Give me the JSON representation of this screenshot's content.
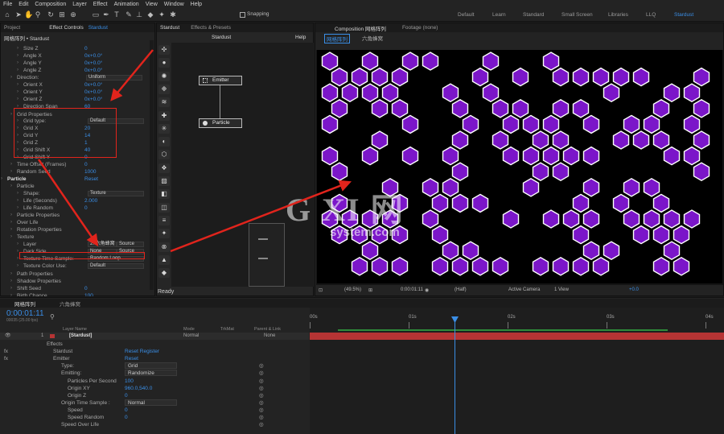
{
  "menu": [
    "File",
    "Edit",
    "Composition",
    "Layer",
    "Effect",
    "Animation",
    "View",
    "Window",
    "Help"
  ],
  "toolbar": {
    "snapping": "Snapping",
    "workspaces": [
      "Default",
      "Learn",
      "Standard",
      "Small Screen",
      "Libraries",
      "LLQ",
      "Stardust"
    ]
  },
  "left_panel": {
    "tabs": [
      "Project",
      "Effect Controls",
      "Stardust"
    ],
    "title": "网格阵列 • Stardust",
    "rows": [
      {
        "label": "Size Z",
        "value": "0"
      },
      {
        "label": "Angle X",
        "value": "0x+0.0°"
      },
      {
        "label": "Angle Y",
        "value": "0x+0.0°"
      },
      {
        "label": "Angle Z",
        "value": "0x+0.0°"
      },
      {
        "label": "Direction:",
        "value": "Uniform"
      },
      {
        "label": "Orient X",
        "value": "0x+0.0°"
      },
      {
        "label": "Orient Y",
        "value": "0x+0.0°"
      },
      {
        "label": "Orient Z",
        "value": "0x+0.0°"
      },
      {
        "label": "Direction Span",
        "value": "60"
      },
      {
        "label": "Grid Properties",
        "value": ""
      },
      {
        "label": "Grid type:",
        "value": "Default"
      },
      {
        "label": "Grid X",
        "value": "20"
      },
      {
        "label": "Grid Y",
        "value": "14"
      },
      {
        "label": "Grid Z",
        "value": "1"
      },
      {
        "label": "Grid Shift X",
        "value": "40"
      },
      {
        "label": "Grid Shift Y",
        "value": "0"
      },
      {
        "label": "Time Offset (Frames)",
        "value": "0"
      },
      {
        "label": "Random Seed",
        "value": "1000"
      },
      {
        "label": "Particle",
        "value": "Reset"
      },
      {
        "label": "Particle",
        "value": ""
      },
      {
        "label": "Shape:",
        "value": "Texture"
      },
      {
        "label": "Life (Seconds)",
        "value": "2.000"
      },
      {
        "label": "Life Random",
        "value": "0"
      },
      {
        "label": "Particle Properties",
        "value": ""
      },
      {
        "label": "Over Life",
        "value": ""
      },
      {
        "label": "Rotation Properties",
        "value": ""
      },
      {
        "label": "Texture",
        "value": ""
      },
      {
        "label": "Layer",
        "value": "2. 六角蜂窝"
      },
      {
        "label": "Dark Side",
        "value": "None"
      },
      {
        "label": "Texture Time Sample:",
        "value": "Random Loop"
      },
      {
        "label": "Texture Color Use:",
        "value": "Default"
      },
      {
        "label": "Path Properties",
        "value": ""
      },
      {
        "label": "Shadow Properties",
        "value": ""
      },
      {
        "label": "Shift Seed",
        "value": "0"
      },
      {
        "label": "Birth Chance",
        "value": "100"
      }
    ],
    "layer_source": "Source",
    "dark_source": "Source"
  },
  "node_panel": {
    "tabs": [
      "Stardust",
      "Effects & Presets"
    ],
    "header": "Stardust",
    "help": "Help",
    "nodes": [
      "Emitter",
      "Particle"
    ],
    "status": "Ready"
  },
  "comp_panel": {
    "tabs": [
      "Composition 网格阵列",
      "Footage (none)"
    ],
    "sub_tabs": [
      "网格阵列",
      "六角蜂窝"
    ],
    "footer": {
      "zoom": "(49.5%)",
      "time": "0:00:01:11",
      "resolution": "(Half)",
      "camera": "Active Camera",
      "views": "1 View",
      "offset": "+0.0"
    }
  },
  "watermark": {
    "main": "G XI 网",
    "sub": "system.com"
  },
  "timeline": {
    "tabs": [
      "网格阵列",
      "六角蜂窝"
    ],
    "timecode": "0:00:01:11",
    "subcode": "00035 (25.00 fps)",
    "columns": [
      "Layer Name",
      "Mode",
      "TrkMat",
      "Parent & Link"
    ],
    "ruler": [
      "00s",
      "01s",
      "02s",
      "03s",
      "04s"
    ],
    "layer": {
      "index": "1",
      "name": "[Stardust]",
      "mode": "Normal",
      "parent": "None"
    },
    "rows": [
      {
        "label": "Effects",
        "value": ""
      },
      {
        "label": "Stardust",
        "value": "Reset   Register"
      },
      {
        "label": "Emitter",
        "value": "Reset"
      },
      {
        "label": "Type:",
        "value": "Grid"
      },
      {
        "label": "Emitting:",
        "value": "Randomize"
      },
      {
        "label": "Particles Per Second",
        "value": "100"
      },
      {
        "label": "Origin XY",
        "value": "960.0,540.0"
      },
      {
        "label": "Origin Z",
        "value": "0"
      },
      {
        "label": "Origin Time Sample :",
        "value": "Normal"
      },
      {
        "label": "Speed",
        "value": "0"
      },
      {
        "label": "Speed Random",
        "value": "0"
      },
      {
        "label": "Speed Over Life",
        "value": ""
      }
    ]
  },
  "colors": {
    "hex_fill": "#7b16c9",
    "hex_stroke": "#ffffff",
    "accent": "#3a8ee6",
    "annotation": "#e1241c",
    "timeline_bar": "#b63434"
  }
}
